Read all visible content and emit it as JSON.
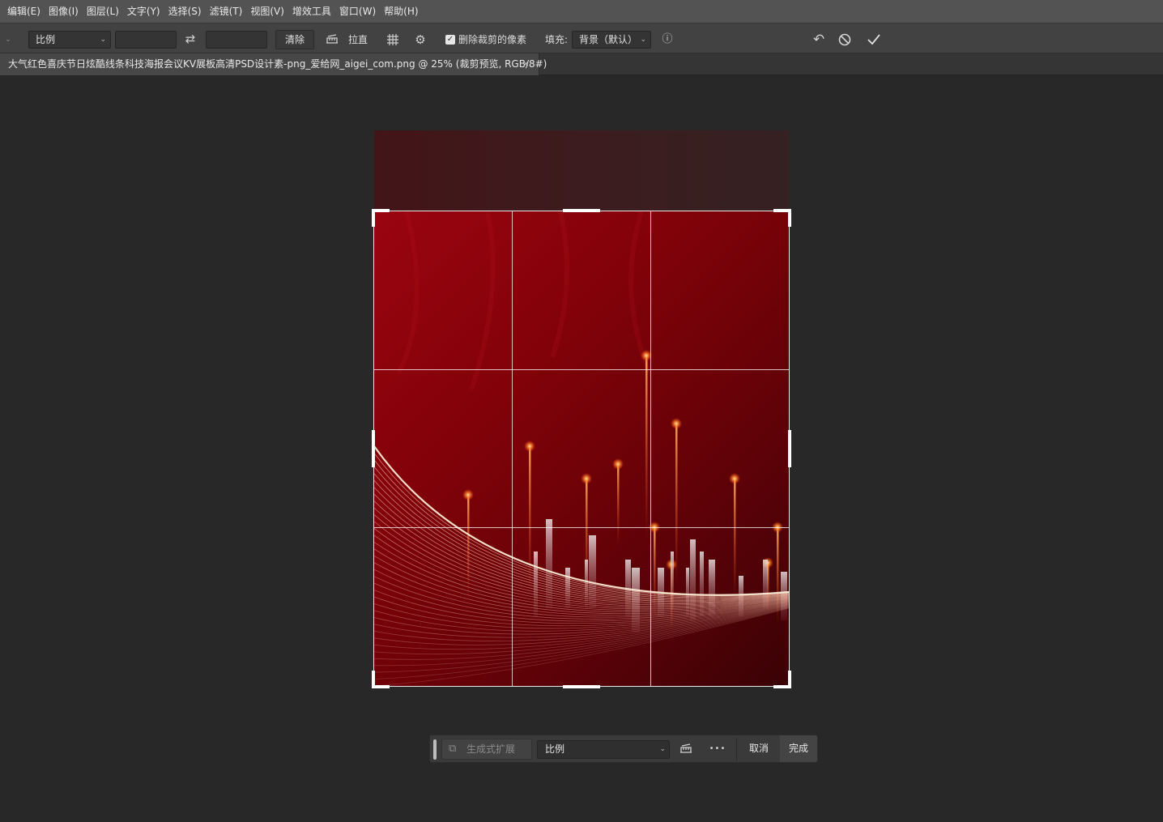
{
  "menu": {
    "items": [
      "编辑(E)",
      "图像(I)",
      "图层(L)",
      "文字(Y)",
      "选择(S)",
      "滤镜(T)",
      "视图(V)",
      "增效工具",
      "窗口(W)",
      "帮助(H)"
    ]
  },
  "options": {
    "ratio_value": "比例",
    "width_value": "",
    "height_value": "",
    "clear_label": "清除",
    "straighten_label": "拉直",
    "delete_pixels_checked": true,
    "delete_pixels_label": "删除裁剪的像素",
    "fill_label": "填充:",
    "fill_value": "背景（默认）",
    "icons": {
      "swap": "swap-icon",
      "straighten": "straighten-icon",
      "overlay": "grid-overlay-icon",
      "settings": "gear-icon",
      "info": "info-icon",
      "reset": "undo-icon",
      "cancel": "cancel-icon",
      "commit": "checkmark-icon"
    }
  },
  "document": {
    "tab_title": "大气红色喜庆节日炫酷线条科技海报会议KV展板高清PSD设计素-png_爱给网_aigei_com.png @ 25% (裁剪预览, RGB/8#)",
    "close_glyph": "×"
  },
  "canvas": {
    "background_color": "#282828",
    "image_colors": {
      "dark_red": "#5e0208",
      "red": "#9a0410",
      "glow": "#ff9a40"
    },
    "crop_grid": "rule-of-thirds"
  },
  "taskbar": {
    "generative_expand_label": "生成式扩展",
    "ratio_value": "比例",
    "more_glyph": "•••",
    "cancel_label": "取消",
    "done_label": "完成"
  }
}
